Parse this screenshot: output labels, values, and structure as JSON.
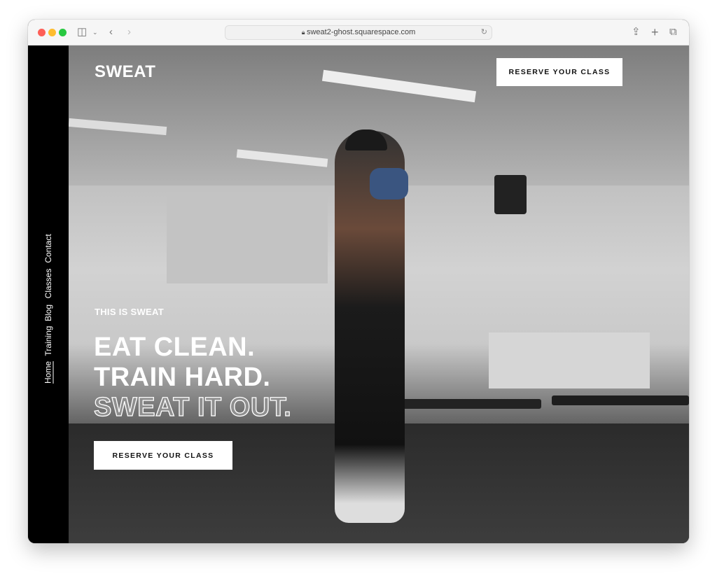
{
  "browser": {
    "url": "sweat2-ghost.squarespace.com",
    "colors": {
      "close": "#fe5f57",
      "minimize": "#febc2e",
      "zoom": "#28c840"
    }
  },
  "site": {
    "logo": "SWEAT",
    "header_button": "RESERVE YOUR CLASS",
    "nav": [
      {
        "label": "Home",
        "active": true
      },
      {
        "label": "Training"
      },
      {
        "label": "Blog"
      },
      {
        "label": "Classes"
      },
      {
        "label": "Contact"
      }
    ],
    "hero": {
      "kicker": "THIS IS SWEAT",
      "line1": "EAT CLEAN.",
      "line2": "TRAIN HARD.",
      "line3": "SWEAT IT OUT.",
      "cta": "RESERVE YOUR CLASS"
    }
  }
}
